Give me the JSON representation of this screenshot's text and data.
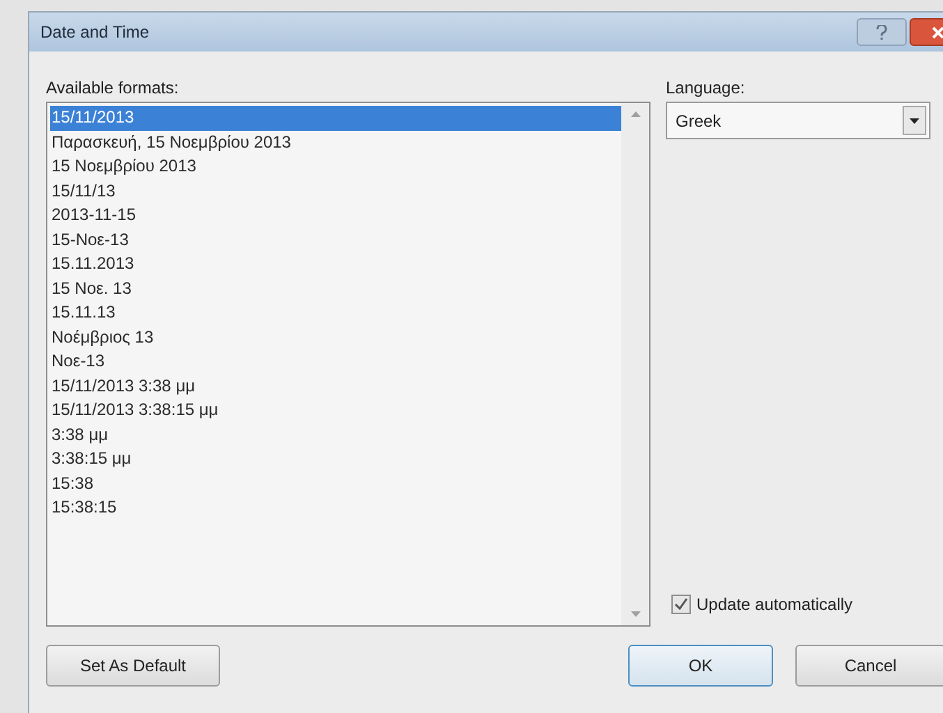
{
  "window": {
    "title": "Date and Time"
  },
  "formats": {
    "label": "Available formats:",
    "items": [
      {
        "text": "15/11/2013",
        "selected": true
      },
      {
        "text": "Παρασκευή, 15 Νοεμβρίου 2013",
        "selected": false
      },
      {
        "text": "15 Νοεμβρίου 2013",
        "selected": false
      },
      {
        "text": "15/11/13",
        "selected": false
      },
      {
        "text": "2013-11-15",
        "selected": false
      },
      {
        "text": "15-Νοε-13",
        "selected": false
      },
      {
        "text": "15.11.2013",
        "selected": false
      },
      {
        "text": "15 Νοε. 13",
        "selected": false
      },
      {
        "text": "15.11.13",
        "selected": false
      },
      {
        "text": "Νοέμβριος 13",
        "selected": false
      },
      {
        "text": "Νοε-13",
        "selected": false
      },
      {
        "text": "15/11/2013 3:38 μμ",
        "selected": false
      },
      {
        "text": "15/11/2013 3:38:15 μμ",
        "selected": false
      },
      {
        "text": "3:38 μμ",
        "selected": false
      },
      {
        "text": "3:38:15 μμ",
        "selected": false
      },
      {
        "text": "15:38",
        "selected": false
      },
      {
        "text": "15:38:15",
        "selected": false
      }
    ]
  },
  "language": {
    "label": "Language:",
    "value": "Greek"
  },
  "update_automatically": {
    "label": "Update automatically",
    "checked": true
  },
  "buttons": {
    "set_default": "Set As Default",
    "ok": "OK",
    "cancel": "Cancel"
  }
}
